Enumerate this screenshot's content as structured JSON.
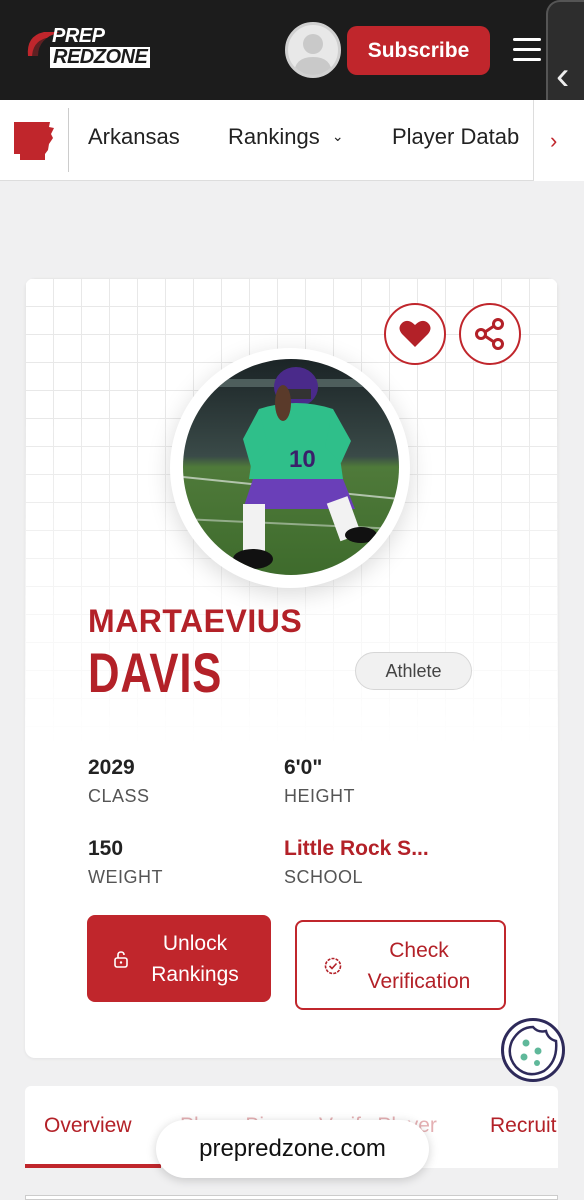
{
  "header": {
    "logo_line1": "PREP",
    "logo_line2": "REDZONE",
    "subscribe_label": "Subscribe"
  },
  "nav": {
    "items": [
      {
        "label": "Arkansas"
      },
      {
        "label": "Rankings"
      },
      {
        "label": "Player Datab"
      }
    ]
  },
  "player": {
    "first_name": "MARTAEVIUS",
    "last_name": "DAVIS",
    "position": "Athlete",
    "stats": [
      {
        "value": "2029",
        "label": "CLASS"
      },
      {
        "value": "6'0\"",
        "label": "HEIGHT"
      },
      {
        "value": "150",
        "label": "WEIGHT"
      },
      {
        "value": "Little Rock S...",
        "label": "SCHOOL"
      }
    ]
  },
  "actions": {
    "unlock_line1": "Unlock",
    "unlock_line2": "Rankings",
    "check_line1": "Check",
    "check_line2": "Verification"
  },
  "tabs": [
    {
      "label": "Overview"
    },
    {
      "label": "Player Bio"
    },
    {
      "label": "Verify Player"
    },
    {
      "label": "Recruit"
    }
  ],
  "browser": {
    "url": "prepredzone.com"
  },
  "colors": {
    "brand_red": "#c0262c",
    "header_bg": "#1c1c1c",
    "page_bg": "#f0f0f1"
  },
  "icons": {
    "favorite": "heart-icon",
    "share": "share-icon",
    "lock": "lock-icon",
    "verify": "check-badge-icon",
    "cookie": "cookie-icon",
    "menu": "hamburger-icon",
    "state": "arkansas-icon"
  }
}
